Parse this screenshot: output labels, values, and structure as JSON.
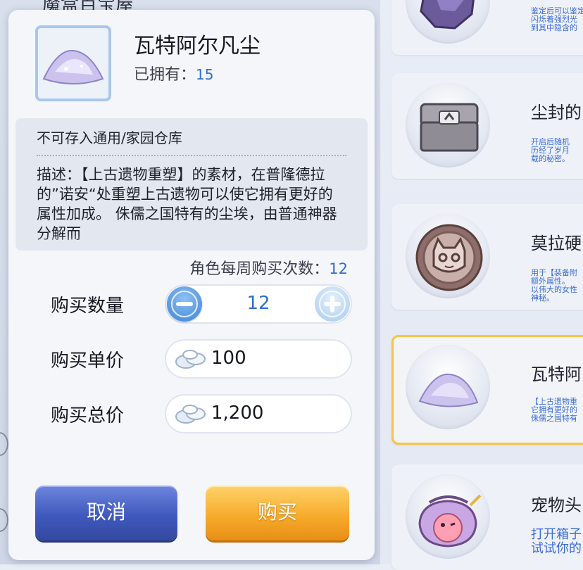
{
  "background": {
    "title": "魔盒百宝屋",
    "items": [
      {
        "name": "",
        "desc": "鉴定后可以鉴定。\n闪烁着强烈光\n到其中隐含的"
      },
      {
        "name": "尘封的",
        "desc": "开启后随机\n历经了岁月\n载的秘密。"
      },
      {
        "name": "莫拉硬",
        "desc": "用于【装备附\n额外属性。\n以伟大的女性\n神秘。"
      },
      {
        "name": "瓦特阿",
        "desc": "【上古遗物重\n它拥有更好的\n侏儒之国特有"
      },
      {
        "name": "宠物头",
        "desc": "打开箱子\n试试你的"
      }
    ]
  },
  "dialog": {
    "item_name": "瓦特阿尔凡尘",
    "owned_label": "已拥有：",
    "owned_count": "15",
    "storage_note": "不可存入通用/家园仓库",
    "description": "描述：【上古遗物重塑】的素材，在普隆德拉的”诺安“处重塑上古遗物可以使它拥有更好的属性加成。\n侏儒之国特有的尘埃，由普通神器分解而",
    "weekly_limit_label": "角色每周购买次数：",
    "weekly_limit_value": "12",
    "quantity_label": "购买数量",
    "quantity_value": "12",
    "unit_price_label": "购买单价",
    "unit_price_value": "100",
    "total_price_label": "购买总价",
    "total_price_value": "1,200",
    "cancel_label": "取消",
    "buy_label": "购买"
  },
  "colors": {
    "accent_blue": "#2f6fd0",
    "cancel_button": "#3f59bd",
    "buy_button": "#f6a828",
    "selected_border": "#f2c64a"
  },
  "icons": [
    "dust-pile-icon",
    "crystal-orb-icon",
    "stone-chest-icon",
    "cat-coin-icon",
    "pet-pouch-icon",
    "minus-icon",
    "plus-icon",
    "zeny-currency-icon"
  ]
}
